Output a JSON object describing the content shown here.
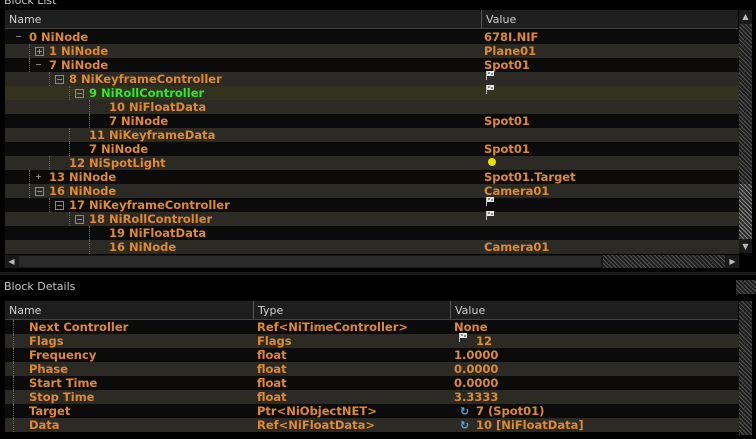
{
  "block_list": {
    "title": "Block List",
    "columns": {
      "name": "Name",
      "value": "Value"
    },
    "rows": [
      {
        "id": "0",
        "name": "0 NiNode",
        "value": "678I.NIF",
        "depth": 0,
        "expander": "−",
        "value_icon": ""
      },
      {
        "id": "1",
        "name": "1 NiNode",
        "value": "Plane01",
        "depth": 1,
        "expander": "+",
        "value_icon": ""
      },
      {
        "id": "7",
        "name": "7 NiNode",
        "value": "Spot01",
        "depth": 1,
        "expander": "−",
        "value_icon": ""
      },
      {
        "id": "8",
        "name": "8 NiKeyframeController",
        "value": "",
        "depth": 2,
        "expander": "−",
        "value_icon": "flag-icon"
      },
      {
        "id": "9",
        "name": "9 NiRollController",
        "value": "",
        "depth": 3,
        "expander": "−",
        "value_icon": "flag-icon",
        "selected": true
      },
      {
        "id": "10",
        "name": "10 NiFloatData",
        "value": "",
        "depth": 4,
        "expander": "",
        "value_icon": ""
      },
      {
        "id": "7b",
        "name": "7 NiNode",
        "value": "Spot01",
        "depth": 4,
        "expander": "",
        "value_icon": ""
      },
      {
        "id": "11",
        "name": "11 NiKeyframeData",
        "value": "",
        "depth": 3,
        "expander": "",
        "value_icon": ""
      },
      {
        "id": "7c",
        "name": "7 NiNode",
        "value": "Spot01",
        "depth": 3,
        "expander": "",
        "value_icon": ""
      },
      {
        "id": "12",
        "name": "12 NiSpotLight",
        "value": "",
        "depth": 2,
        "expander": "",
        "value_icon": "dot-icon"
      },
      {
        "id": "13",
        "name": "13 NiNode",
        "value": "Spot01.Target",
        "depth": 1,
        "expander": "+",
        "value_icon": ""
      },
      {
        "id": "16",
        "name": "16 NiNode",
        "value": "Camera01",
        "depth": 1,
        "expander": "−",
        "value_icon": ""
      },
      {
        "id": "17",
        "name": "17 NiKeyframeController",
        "value": "",
        "depth": 2,
        "expander": "−",
        "value_icon": "flag-icon"
      },
      {
        "id": "18",
        "name": "18 NiRollController",
        "value": "",
        "depth": 3,
        "expander": "−",
        "value_icon": "flag-icon"
      },
      {
        "id": "19",
        "name": "19 NiFloatData",
        "value": "",
        "depth": 4,
        "expander": "",
        "value_icon": ""
      },
      {
        "id": "16b",
        "name": "16 NiNode",
        "value": "Camera01",
        "depth": 4,
        "expander": "",
        "value_icon": ""
      }
    ]
  },
  "block_details": {
    "title": "Block Details",
    "columns": {
      "name": "Name",
      "type": "Type",
      "value": "Value"
    },
    "rows": [
      {
        "name": "Next Controller",
        "type": "Ref<NiTimeController>",
        "value": "None",
        "value_icon": ""
      },
      {
        "name": "Flags",
        "type": "Flags",
        "value": "12",
        "value_icon": "flag-icon"
      },
      {
        "name": "Frequency",
        "type": "float",
        "value": "1.0000",
        "value_icon": ""
      },
      {
        "name": "Phase",
        "type": "float",
        "value": "0.0000",
        "value_icon": ""
      },
      {
        "name": "Start Time",
        "type": "float",
        "value": "0.0000",
        "value_icon": ""
      },
      {
        "name": "Stop Time",
        "type": "float",
        "value": "3.3333",
        "value_icon": ""
      },
      {
        "name": "Target",
        "type": "Ptr<NiObjectNET>",
        "value": "7 (Spot01)",
        "value_icon": "link-icon"
      },
      {
        "name": "Data",
        "type": "Ref<NiFloatData>",
        "value": "10 [NiFloatData]",
        "value_icon": "link-icon"
      }
    ]
  },
  "colors": {
    "text_orange": "#e08a30",
    "selected_green": "#2ee82e",
    "row_alt": "#2c2a24",
    "header_bg": "#1e1e1e"
  }
}
